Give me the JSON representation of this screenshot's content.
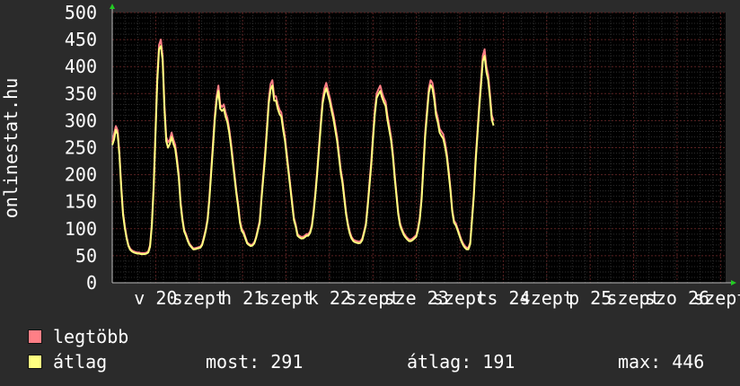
{
  "chart_data": {
    "type": "line",
    "ylabel": "onlinestat.hu",
    "ylim": [
      0,
      500
    ],
    "yticks": [
      "0",
      "50",
      "100",
      "150",
      "200",
      "250",
      "300",
      "350",
      "400",
      "450",
      "500"
    ],
    "xticks": [
      "v 20",
      "szept",
      "h 21",
      "szept",
      "k 22",
      "szept",
      "sze 23",
      "szept",
      "cs 24",
      "szept",
      "p 25",
      "szept",
      "szo 26",
      "szept"
    ],
    "grid": true,
    "series": [
      {
        "name": "legtöbb",
        "color": "#ff7f86"
      },
      {
        "name": "átlag",
        "color": "#ffff80"
      }
    ],
    "x": [
      0,
      2,
      4,
      6,
      8,
      10,
      12,
      14,
      16,
      18,
      20,
      22,
      24,
      26,
      28,
      30,
      32,
      34,
      36,
      38,
      40,
      42,
      44,
      46,
      48,
      50,
      52,
      54,
      56,
      58,
      60,
      62,
      64,
      66,
      68,
      70,
      72,
      74,
      76,
      78,
      80,
      82,
      84,
      86,
      88,
      90,
      92,
      94,
      96,
      98,
      100,
      102,
      104,
      106,
      108,
      110,
      112,
      114,
      116,
      118,
      120,
      122,
      124,
      126,
      128,
      130,
      132,
      134,
      136,
      138,
      140,
      142,
      144,
      146,
      148,
      150,
      152,
      154,
      156,
      158,
      160,
      162,
      164,
      166,
      168,
      170,
      172,
      174,
      176,
      178,
      180,
      182,
      184,
      186,
      188,
      190,
      192,
      194,
      196,
      198,
      200,
      202,
      204,
      206,
      208,
      210,
      212,
      214,
      216,
      218,
      220,
      222,
      224,
      226,
      228,
      230,
      232,
      234,
      236,
      238,
      240,
      242,
      244,
      246,
      248,
      250,
      252,
      254,
      256,
      258,
      260,
      262,
      264,
      266,
      268,
      270,
      272,
      274,
      276,
      278,
      280,
      282,
      284,
      286,
      288,
      290,
      292,
      294,
      296,
      298,
      300,
      302,
      304,
      306,
      308,
      310,
      312,
      314,
      316,
      318,
      320,
      322,
      324,
      326,
      328,
      330,
      332,
      334,
      336,
      338,
      340,
      342,
      344,
      346,
      348,
      350,
      352,
      354,
      356,
      358,
      360,
      362,
      364,
      366,
      368,
      370,
      372,
      374,
      376,
      378,
      380,
      382,
      384,
      386,
      388,
      390,
      392,
      394,
      396,
      398,
      400,
      402,
      404,
      406,
      408,
      410,
      412,
      414,
      416,
      418,
      420,
      422,
      424,
      426,
      428,
      430,
      432,
      434,
      436,
      438,
      440,
      442,
      444,
      446,
      448,
      450,
      452,
      454,
      456,
      458,
      460,
      462,
      464,
      466,
      468,
      470,
      472,
      474,
      476,
      478,
      480,
      482,
      484,
      486,
      488,
      490,
      492,
      494,
      496,
      498,
      500,
      502,
      504,
      506,
      508,
      510,
      512,
      514,
      516,
      518,
      520,
      522,
      524,
      526,
      528,
      530,
      532,
      534,
      536,
      538,
      540,
      542,
      544,
      546,
      548,
      550,
      552,
      554,
      556,
      558,
      560,
      562,
      564,
      566,
      568,
      570,
      572,
      574,
      576,
      578,
      580,
      582,
      584,
      586,
      588,
      590,
      592,
      594,
      596,
      598,
      600,
      602,
      604,
      606,
      608,
      610,
      612,
      614,
      616,
      618,
      620,
      622,
      624,
      626,
      628,
      630,
      632,
      634,
      636,
      638,
      640,
      642,
      644,
      646,
      648,
      650,
      652,
      654,
      656,
      658,
      660,
      662,
      664,
      666,
      668,
      670,
      672,
      674,
      676,
      678,
      680,
      682
    ],
    "max_values": [
      260,
      275,
      290,
      282,
      240,
      180,
      130,
      105,
      85,
      70,
      63,
      60,
      58,
      57,
      56,
      56,
      55,
      55,
      55,
      56,
      58,
      70,
      110,
      180,
      280,
      380,
      440,
      450,
      420,
      330,
      270,
      260,
      265,
      278,
      265,
      255,
      230,
      200,
      150,
      120,
      98,
      90,
      80,
      72,
      68,
      64,
      64,
      65,
      66,
      67,
      72,
      85,
      100,
      120,
      160,
      210,
      260,
      310,
      345,
      365,
      330,
      325,
      330,
      315,
      305,
      285,
      260,
      230,
      200,
      170,
      145,
      115,
      100,
      95,
      85,
      75,
      72,
      70,
      71,
      75,
      85,
      100,
      115,
      160,
      200,
      240,
      290,
      340,
      368,
      375,
      345,
      345,
      330,
      320,
      315,
      290,
      270,
      240,
      210,
      180,
      150,
      120,
      108,
      90,
      87,
      85,
      85,
      87,
      90,
      90,
      95,
      108,
      135,
      170,
      210,
      255,
      300,
      340,
      360,
      370,
      355,
      342,
      325,
      310,
      290,
      270,
      240,
      210,
      190,
      160,
      130,
      110,
      95,
      85,
      80,
      78,
      77,
      76,
      77,
      82,
      95,
      110,
      145,
      185,
      225,
      275,
      320,
      350,
      358,
      365,
      352,
      342,
      335,
      310,
      290,
      270,
      240,
      200,
      165,
      130,
      110,
      100,
      92,
      87,
      83,
      80,
      80,
      82,
      85,
      88,
      102,
      122,
      160,
      220,
      280,
      320,
      360,
      375,
      370,
      350,
      318,
      305,
      285,
      280,
      275,
      260,
      240,
      210,
      175,
      135,
      115,
      110,
      100,
      90,
      80,
      73,
      68,
      65,
      65,
      75,
      120,
      165,
      230,
      280,
      330,
      375,
      420,
      432,
      400,
      385,
      350,
      310,
      300
    ],
    "avg_values": [
      255,
      265,
      283,
      275,
      235,
      175,
      126,
      101,
      82,
      68,
      61,
      58,
      56,
      55,
      54,
      54,
      53,
      53,
      53,
      54,
      56,
      67,
      106,
      175,
      272,
      372,
      432,
      438,
      412,
      322,
      262,
      250,
      257,
      270,
      257,
      248,
      223,
      194,
      145,
      116,
      95,
      87,
      77,
      70,
      66,
      62,
      62,
      63,
      64,
      65,
      70,
      82,
      97,
      116,
      155,
      204,
      252,
      302,
      337,
      355,
      322,
      318,
      322,
      307,
      297,
      278,
      253,
      223,
      194,
      165,
      140,
      111,
      96,
      91,
      82,
      73,
      70,
      68,
      69,
      73,
      83,
      97,
      111,
      155,
      194,
      233,
      282,
      332,
      358,
      365,
      337,
      337,
      322,
      312,
      307,
      283,
      263,
      233,
      204,
      175,
      145,
      116,
      104,
      87,
      84,
      82,
      82,
      84,
      87,
      87,
      92,
      104,
      131,
      165,
      204,
      248,
      292,
      332,
      350,
      360,
      347,
      334,
      317,
      302,
      282,
      262,
      233,
      204,
      184,
      155,
      126,
      106,
      91,
      82,
      77,
      75,
      74,
      73,
      74,
      79,
      92,
      106,
      140,
      179,
      218,
      267,
      312,
      342,
      349,
      355,
      343,
      334,
      327,
      302,
      282,
      263,
      233,
      194,
      160,
      126,
      106,
      97,
      89,
      84,
      80,
      77,
      77,
      79,
      82,
      85,
      98,
      118,
      155,
      214,
      272,
      312,
      352,
      366,
      360,
      340,
      310,
      297,
      278,
      272,
      267,
      252,
      233,
      204,
      170,
      131,
      111,
      106,
      97,
      87,
      77,
      70,
      65,
      62,
      62,
      72,
      116,
      160,
      223,
      272,
      322,
      365,
      410,
      420,
      390,
      375,
      342,
      302,
      291
    ]
  },
  "legend": [
    {
      "label": "legtöbb",
      "color": "#ff7f86"
    },
    {
      "label": "átlag",
      "color": "#ffff80"
    }
  ],
  "stats": {
    "most": "most: 291",
    "atlag": "átlag: 191",
    "max": "max: 446"
  }
}
